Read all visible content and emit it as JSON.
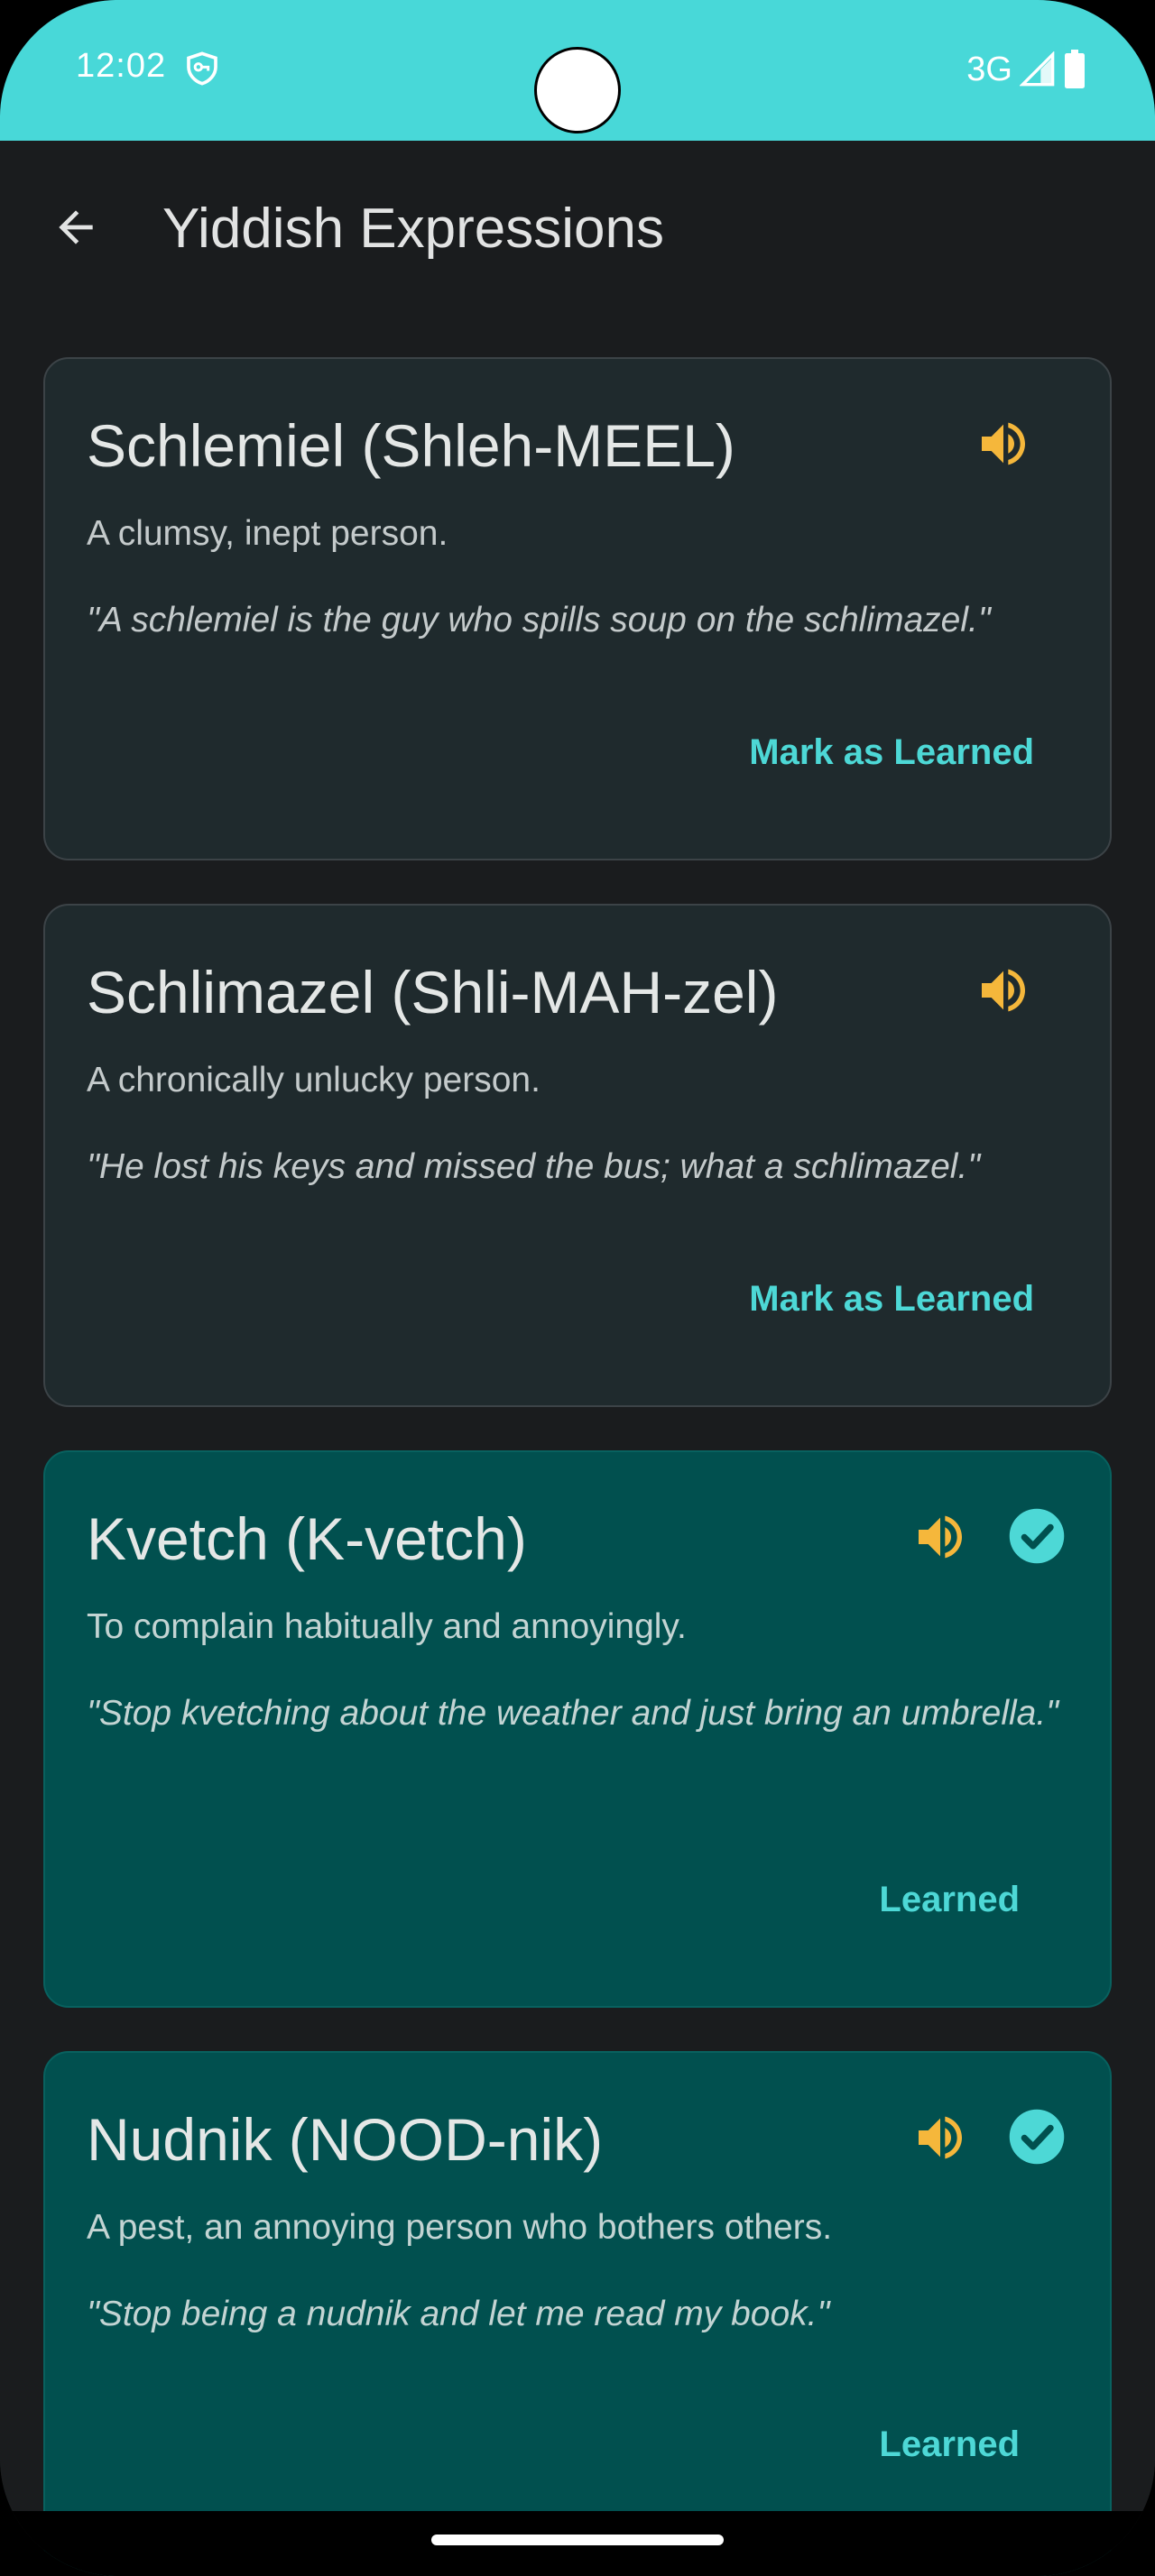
{
  "status_bar": {
    "time": "12:02",
    "network": "3G",
    "vpn_icon": "vpn-key-icon",
    "signal_icon": "signal-icon",
    "battery_icon": "battery-icon"
  },
  "app_bar": {
    "title": "Yiddish Expressions",
    "back_icon": "arrow-back-icon"
  },
  "colors": {
    "status_bar": "#48d8d8",
    "background": "#1a1c1e",
    "card": "#1f2a2d",
    "card_learned": "#01504f",
    "accent": "#4dd8d6",
    "speaker": "#f5b73b"
  },
  "cards": [
    {
      "term": "Schlemiel (Shleh-MEEL)",
      "definition": "A clumsy, inept person.",
      "example": "\"A schlemiel is the guy who spills soup on the schlimazel.\"",
      "action": "Mark as Learned",
      "learned": false
    },
    {
      "term": "Schlimazel (Shli-MAH-zel)",
      "definition": "A chronically unlucky person.",
      "example": "\"He lost his keys and missed the bus; what a schlimazel.\"",
      "action": "Mark as Learned",
      "learned": false
    },
    {
      "term": "Kvetch (K-vetch)",
      "definition": "To complain habitually and annoyingly.",
      "example": "\"Stop kvetching about the weather and just bring an umbrella.\"",
      "action": "Learned",
      "learned": true
    },
    {
      "term": "Nudnik (NOOD-nik)",
      "definition": "A pest, an annoying person who bothers others.",
      "example": "\"Stop being a nudnik and let me read my book.\"",
      "action": "Learned",
      "learned": true
    }
  ]
}
